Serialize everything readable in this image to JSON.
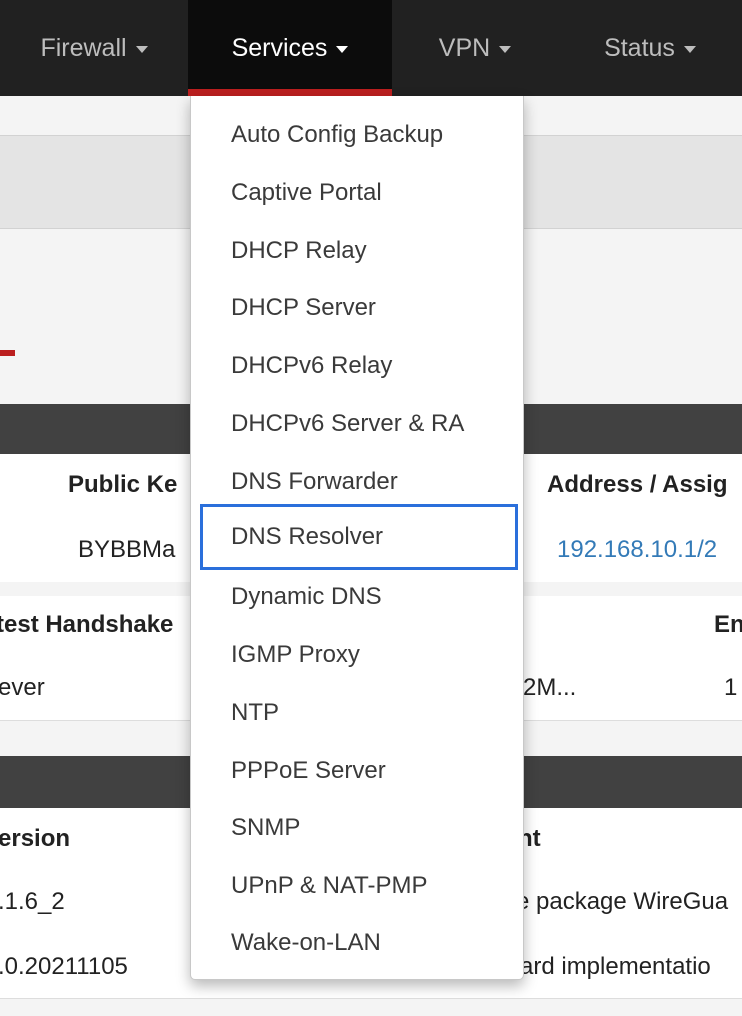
{
  "navbar": {
    "items": [
      {
        "label": "Firewall"
      },
      {
        "label": "Services"
      },
      {
        "label": "VPN"
      },
      {
        "label": "Status"
      }
    ]
  },
  "services_menu": {
    "items": [
      {
        "label": "Auto Config Backup"
      },
      {
        "label": "Captive Portal"
      },
      {
        "label": "DHCP Relay"
      },
      {
        "label": "DHCP Server"
      },
      {
        "label": "DHCPv6 Relay"
      },
      {
        "label": "DHCPv6 Server & RA"
      },
      {
        "label": "DNS Forwarder"
      },
      {
        "label": "DNS Resolver"
      },
      {
        "label": "Dynamic DNS"
      },
      {
        "label": "IGMP Proxy"
      },
      {
        "label": "NTP"
      },
      {
        "label": "PPPoE Server"
      },
      {
        "label": "SNMP"
      },
      {
        "label": "UPnP & NAT-PMP"
      },
      {
        "label": "Wake-on-LAN"
      }
    ],
    "highlighted": "DNS Resolver"
  },
  "background": {
    "tunnels_table": {
      "headers": [
        "Public Ke",
        "Address / Assig"
      ],
      "row": [
        "BYBBMa",
        "192.168.10.1/2"
      ]
    },
    "peers_table": {
      "headers": [
        "test Handshake",
        "En"
      ],
      "row": [
        "ever",
        "2M...",
        "1"
      ]
    },
    "packages_table": {
      "headers": [
        "ersion",
        "nt"
      ],
      "rows": [
        [
          ".1.6_2",
          "e package WireGua"
        ],
        [
          ".0.20211105",
          "ard implementatio"
        ]
      ]
    }
  },
  "colors": {
    "navbar_bg": "#212121",
    "active_tab_bg": "#0c0c0c",
    "accent_red": "#bb1f1f",
    "panel_head": "#414141",
    "link_blue": "#337ab7",
    "highlight_blue": "#2a6fdb"
  }
}
